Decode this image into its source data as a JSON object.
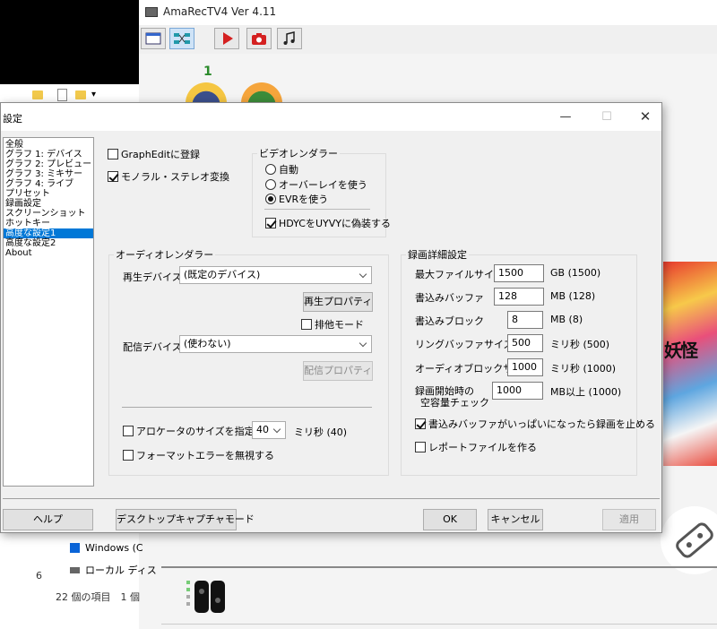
{
  "amarec": {
    "title": "AmaRecTV4 Ver 4.11",
    "avatar_count": "1",
    "game_text": "妖怪"
  },
  "explorer": {
    "side_num": "6",
    "tree_items": [
      "Windows (C",
      "ローカル ディス"
    ],
    "status": "22 個の項目　1 個"
  },
  "dialog": {
    "title": "設定",
    "nav_items": [
      "全般",
      "グラフ 1: デバイス",
      "グラフ 2: プレビュー",
      "グラフ 3: ミキサー",
      "グラフ 4: ライブ",
      "プリセット",
      "録画設定",
      "スクリーンショット",
      "ホットキー",
      "高度な設定1",
      "高度な設定2",
      "About"
    ],
    "nav_selected": "高度な設定1",
    "graphedit": {
      "label": "GraphEditに登録",
      "checked": false
    },
    "mono_stereo": {
      "label": "モノラル・ステレオ変換",
      "checked": true
    },
    "video_renderer": {
      "title": "ビデオレンダラー",
      "options": [
        "自動",
        "オーバーレイを使う",
        "EVRを使う"
      ],
      "selected": "EVRを使う",
      "hdyc": {
        "label": "HDYCをUYVYに偽装する",
        "checked": true
      }
    },
    "audio_renderer": {
      "title": "オーディオレンダラー",
      "playback_label": "再生デバイス",
      "playback_value": "(既定のデバイス)",
      "playback_props": "再生プロパティ",
      "exclusive": {
        "label": "排他モード",
        "checked": false
      },
      "delivery_label": "配信デバイス",
      "delivery_value": "(使わない)",
      "delivery_props": "配信プロパティ",
      "allocator": {
        "label": "アロケータのサイズを指定する",
        "checked": false
      },
      "allocator_value": "40",
      "allocator_unit": "ミリ秒 (40)",
      "format_error": {
        "label": "フォーマットエラーを無視する",
        "checked": false
      }
    },
    "recording": {
      "title": "録画詳細設定",
      "rows": [
        {
          "label": "最大ファイルサイズ",
          "value": "1500",
          "unit": "GB (1500)"
        },
        {
          "label": "書込みバッファ",
          "value": "128",
          "unit": "MB (128)"
        },
        {
          "label": "書込みブロック",
          "value": "8",
          "unit": "MB (8)"
        },
        {
          "label": "リングバッファサイズ",
          "value": "500",
          "unit": "ミリ秒 (500)"
        },
        {
          "label": "オーディオブロックサイズ",
          "value": "1000",
          "unit": "ミリ秒 (1000)"
        }
      ],
      "free_check_label_1": "録画開始時の",
      "free_check_label_2": "空容量チェック",
      "free_check_value": "1000",
      "free_check_unit": "MB以上 (1000)",
      "stop_when_full": {
        "label": "書込みバッファがいっぱいになったら録画を止める",
        "checked": true
      },
      "report_file": {
        "label": "レポートファイルを作る",
        "checked": false
      }
    },
    "buttons": {
      "help": "ヘルプ",
      "desktop_capture": "デスクトップキャプチャモード",
      "ok": "OK",
      "cancel": "キャンセル",
      "apply": "適用"
    }
  }
}
